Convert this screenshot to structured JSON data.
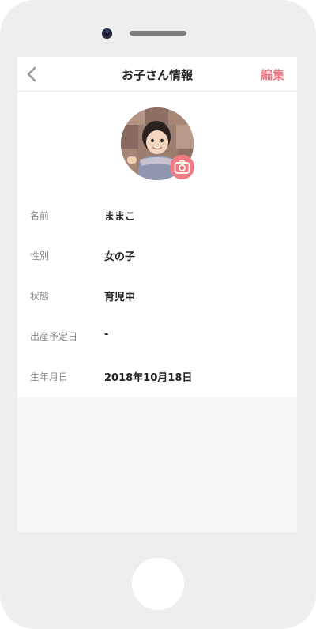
{
  "header": {
    "title": "お子さん情報",
    "edit_label": "編集",
    "back_icon": "chevron-left-icon"
  },
  "profile": {
    "avatar": "child-photo",
    "camera_icon": "camera-icon",
    "accent_color": "#ef7b84"
  },
  "fields": [
    {
      "label": "名前",
      "value": "ままこ"
    },
    {
      "label": "性別",
      "value": "女の子"
    },
    {
      "label": "状態",
      "value": "育児中"
    },
    {
      "label": "出産予定日",
      "value": "-"
    },
    {
      "label": "生年月日",
      "value": "2018年10月18日"
    }
  ]
}
